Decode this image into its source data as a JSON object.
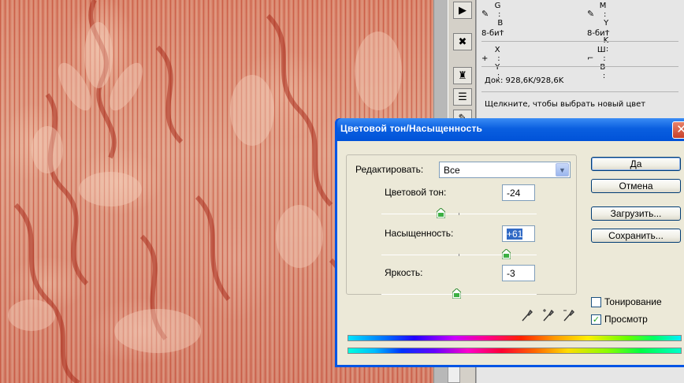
{
  "info_panel": {
    "rgb_g_label": "G :",
    "rgb_b_label": "B :",
    "cmyk_m_label": "M :",
    "cmyk_y_label": "Y :",
    "cmyk_k_label": "K :",
    "bit_left": "8-бит",
    "bit_right": "8-бит",
    "x_label": "X :",
    "y_label": "Y :",
    "w_label": "Ш :",
    "h_label": "В :",
    "doc_size": "Док: 928,6K/928,6K",
    "hint": "Щелкните, чтобы выбрать новый цвет"
  },
  "dialog": {
    "title": "Цветовой тон/Насыщенность",
    "close_symbol": "✕",
    "edit_label": "Редактировать:",
    "edit_value": "Все",
    "hue_label": "Цветовой тон:",
    "hue_value": "-24",
    "saturation_label": "Насыщенность:",
    "saturation_value": "+61",
    "lightness_label": "Яркость:",
    "lightness_value": "-3",
    "ok_label": "Да",
    "cancel_label": "Отмена",
    "load_label": "Загрузить...",
    "save_label": "Сохранить...",
    "colorize_label": "Тонирование",
    "colorize_checked": false,
    "preview_label": "Просмотр",
    "preview_checked": true
  },
  "slider_levels": {
    "hue": -24,
    "hue_range": [
      -180,
      180
    ],
    "saturation": 61,
    "saturation_range": [
      -100,
      100
    ],
    "lightness": -3,
    "lightness_range": [
      -100,
      100
    ]
  },
  "colors": {
    "title_bar": "#0a5fe0",
    "dialog_bg": "#ece9d8",
    "canvas_base": "#d8907a"
  },
  "icons": {
    "tool_1": "play-icon",
    "tool_2": "tools-icon",
    "tool_3": "stamp-icon",
    "tool_4": "layers-icon",
    "tool_5": "brush-icon",
    "eyedroppers": [
      "eyedropper-icon",
      "eyedropper-plus-icon",
      "eyedropper-minus-icon"
    ]
  }
}
